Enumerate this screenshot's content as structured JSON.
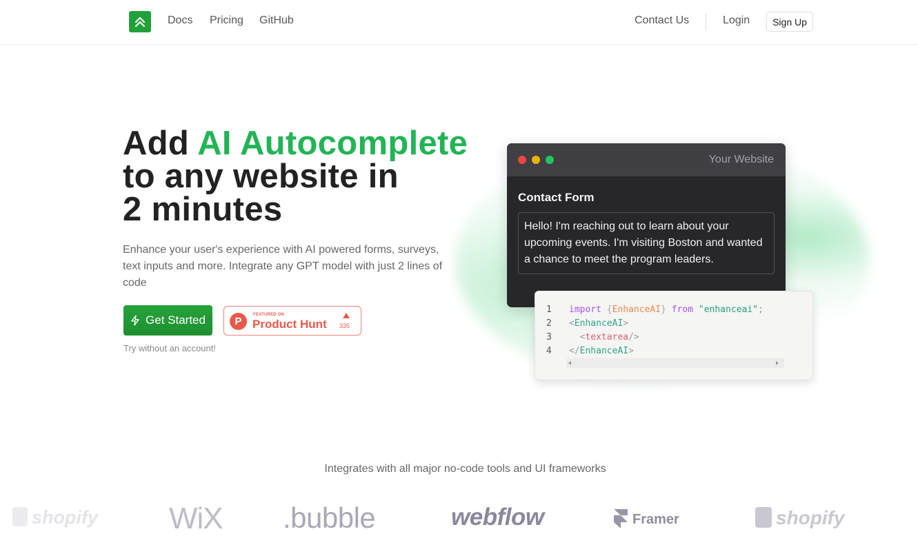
{
  "nav": {
    "links": [
      "Docs",
      "Pricing",
      "GitHub"
    ],
    "contact": "Contact Us",
    "login": "Login",
    "signup": "Sign Up",
    "logo_icon": "double-chevron-up-icon",
    "brand_color": "#22a13b"
  },
  "hero": {
    "headline_pre": "Add ",
    "headline_accent": "AI Autocomplete",
    "headline_line2": "to any website in",
    "headline_line3": "2 minutes",
    "accent_color": "#22b455",
    "subtitle": "Enhance your user's experience with AI powered forms, surveys, text inputs and more. Integrate any GPT model with just 2 lines of code",
    "cta_label": "Get Started",
    "cta_icon": "lightning-icon",
    "try_text": "Try without an account!",
    "product_hunt": {
      "featured": "FEATURED ON",
      "name": "Product Hunt",
      "logo_letter": "P",
      "votes": "335",
      "color": "#e8594b"
    }
  },
  "demo": {
    "window_title": "Your Website",
    "form_title": "Contact Form",
    "textarea_value": "Hello! I'm reaching out to learn about your upcoming events. I'm visiting Boston and wanted a chance to meet the program leaders.",
    "dots": [
      "#ef4444",
      "#eab308",
      "#22c55e"
    ],
    "code_lines": [
      {
        "n": "1",
        "text": "import {EnhanceAI} from \"enhanceai\";"
      },
      {
        "n": "2",
        "text": "<EnhanceAI>"
      },
      {
        "n": "3",
        "text": "  <textarea/>"
      },
      {
        "n": "4",
        "text": "</EnhanceAI>"
      }
    ],
    "code_tokens": {
      "import": "import",
      "lbrace": "{",
      "ident": "EnhanceAI",
      "rbrace": "}",
      "from": "from",
      "module": "\"enhanceai\"",
      "semi": ";",
      "open_tag": "EnhanceAI",
      "inner_tag": "textarea",
      "close_tag": "EnhanceAI"
    }
  },
  "integrations": {
    "heading": "Integrates with all major no-code tools and UI frameworks",
    "logos": [
      "shopify",
      "WiX",
      ".bubble",
      "webflow",
      "Framer",
      "shopify"
    ]
  }
}
